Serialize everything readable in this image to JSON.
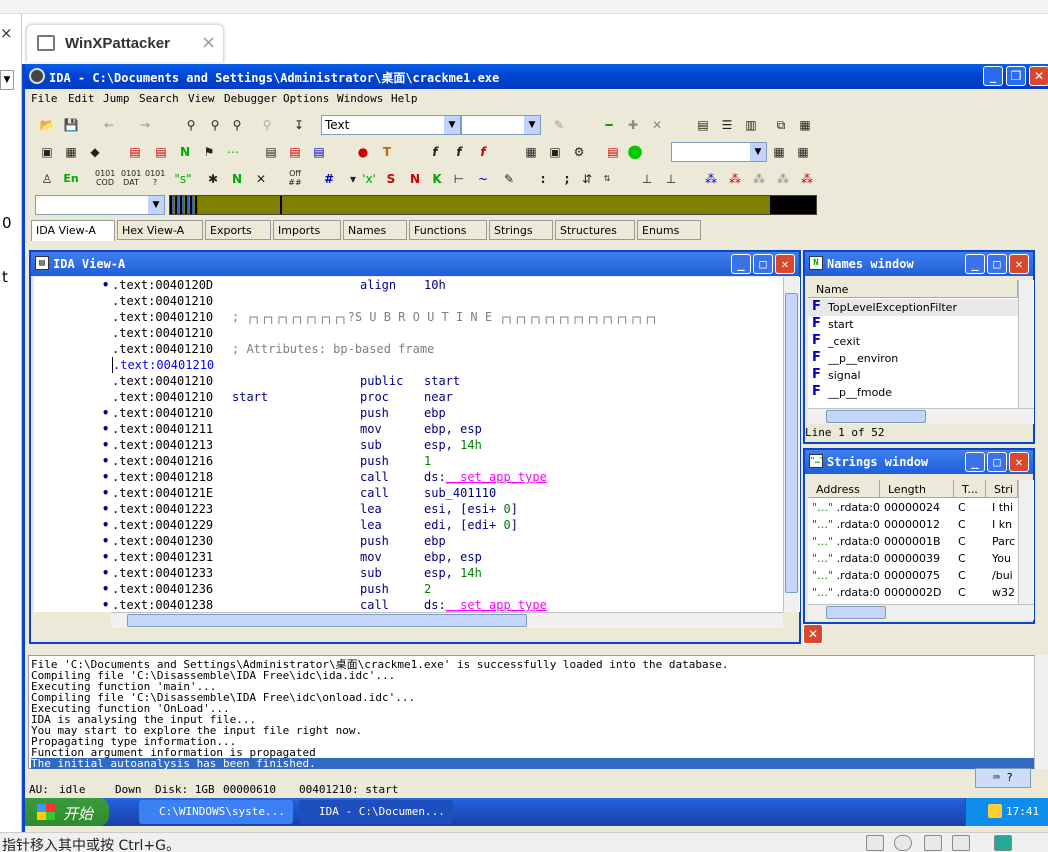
{
  "host": {
    "tab_title": "WinXPattacker",
    "left_char_0": "0",
    "left_char_t": "t",
    "bottom_hint": "指针移入其中或按 Ctrl+G。"
  },
  "ida": {
    "window_title": "IDA - C:\\Documents and Settings\\Administrator\\桌面\\crackme1.exe",
    "menu": [
      "File",
      "Edit",
      "Jump",
      "Search",
      "View",
      "Debugger",
      "Options",
      "Windows",
      "Help"
    ],
    "toolbar": {
      "text_combo": "Text",
      "empty_combo": "",
      "lang_label": "En"
    },
    "tabs": [
      {
        "label": "IDA View-A",
        "active": true
      },
      {
        "label": "Hex View-A"
      },
      {
        "label": "Exports"
      },
      {
        "label": "Imports"
      },
      {
        "label": "Names"
      },
      {
        "label": "Functions"
      },
      {
        "label": "Strings"
      },
      {
        "label": "Structures"
      },
      {
        "label": "Enums"
      }
    ],
    "view_title": "IDA View-A",
    "code_lines": [
      {
        "dot": true,
        "addr": ".text:0040120D",
        "lab": "",
        "ins": "align",
        "ops": "10h",
        "kind": "plain"
      },
      {
        "dot": false,
        "addr": ".text:00401210",
        "lab": "",
        "ins": "",
        "ops": "",
        "kind": "plain"
      },
      {
        "dot": false,
        "addr": ".text:00401210",
        "cmt": "; ┌┐┌┐┌┐┌┐┌┐┌┐┌┐?S U B R O U T I N E ┌┐┌┐┌┐┌┐┌┐┌┐┌┐┌┐┌┐┌┐┌┐",
        "kind": "comment"
      },
      {
        "dot": false,
        "addr": ".text:00401210",
        "lab": "",
        "ins": "",
        "ops": "",
        "kind": "plain"
      },
      {
        "dot": false,
        "addr": ".text:00401210",
        "cmt": "; Attributes: bp-based frame",
        "kind": "comment"
      },
      {
        "dot": false,
        "addr": ".text:00401210",
        "lab": "",
        "ins": "",
        "ops": "",
        "kind": "cursor"
      },
      {
        "dot": false,
        "addr": ".text:00401210",
        "lab": "",
        "ins": "public",
        "ops": "start",
        "kind": "plain"
      },
      {
        "dot": false,
        "addr": ".text:00401210",
        "lab": "start",
        "ins": "proc",
        "ops": "near",
        "kind": "plain"
      },
      {
        "dot": true,
        "addr": ".text:00401210",
        "lab": "",
        "ins": "push",
        "ops": "ebp",
        "kind": "plain"
      },
      {
        "dot": true,
        "addr": ".text:00401211",
        "lab": "",
        "ins": "mov",
        "ops": "ebp, esp",
        "kind": "plain"
      },
      {
        "dot": true,
        "addr": ".text:00401213",
        "lab": "",
        "ins": "sub",
        "ops": "esp,",
        "num": "14h",
        "kind": "num"
      },
      {
        "dot": true,
        "addr": ".text:00401216",
        "lab": "",
        "ins": "push",
        "ops": "",
        "num": "1",
        "kind": "num"
      },
      {
        "dot": true,
        "addr": ".text:00401218",
        "lab": "",
        "ins": "call",
        "ops": "ds:",
        "imp": "__set_app_type",
        "kind": "imp"
      },
      {
        "dot": true,
        "addr": ".text:0040121E",
        "lab": "",
        "ins": "call",
        "ops": "sub_401110",
        "kind": "plain"
      },
      {
        "dot": true,
        "addr": ".text:00401223",
        "lab": "",
        "ins": "lea",
        "ops": "esi, [esi+",
        "num": "0",
        "tail": "]",
        "kind": "num"
      },
      {
        "dot": true,
        "addr": ".text:00401229",
        "lab": "",
        "ins": "lea",
        "ops": "edi, [edi+",
        "num": "0",
        "tail": "]",
        "kind": "num"
      },
      {
        "dot": true,
        "addr": ".text:00401230",
        "lab": "",
        "ins": "push",
        "ops": "ebp",
        "kind": "plain"
      },
      {
        "dot": true,
        "addr": ".text:00401231",
        "lab": "",
        "ins": "mov",
        "ops": "ebp, esp",
        "kind": "plain"
      },
      {
        "dot": true,
        "addr": ".text:00401233",
        "lab": "",
        "ins": "sub",
        "ops": "esp,",
        "num": "14h",
        "kind": "num"
      },
      {
        "dot": true,
        "addr": ".text:00401236",
        "lab": "",
        "ins": "push",
        "ops": "",
        "num": "2",
        "kind": "num"
      },
      {
        "dot": true,
        "addr": ".text:00401238",
        "lab": "",
        "ins": "call",
        "ops": "ds:",
        "imp": "__set_app_type",
        "kind": "imp"
      }
    ],
    "names_window": {
      "title": "Names window",
      "header": "Name",
      "rows": [
        "TopLevelExceptionFilter",
        "start",
        "_cexit",
        "__p__environ",
        "signal",
        "__p__fmode"
      ],
      "status": "Line 1 of 52"
    },
    "strings_window": {
      "title": "Strings window",
      "headers": [
        "Address",
        "Length",
        "T...",
        "Stri"
      ],
      "rows": [
        [
          ".rdata:0...",
          "00000024",
          "C",
          "I thi"
        ],
        [
          ".rdata:0...",
          "00000012",
          "C",
          "I kn"
        ],
        [
          ".rdata:0...",
          "0000001B",
          "C",
          "Parc"
        ],
        [
          ".rdata:0...",
          "00000039",
          "C",
          "You"
        ],
        [
          ".rdata:0...",
          "00000075",
          "C",
          "/bui"
        ],
        [
          ".rdata:0...",
          "0000002D",
          "C",
          "w32"
        ]
      ]
    },
    "log_lines": [
      "File 'C:\\Documents and Settings\\Administrator\\桌面\\crackme1.exe' is successfully loaded into the database.",
      "Compiling file 'C:\\Disassemble\\IDA Free\\idc\\ida.idc'...",
      "Executing function 'main'...",
      "Compiling file 'C:\\Disassemble\\IDA Free\\idc\\onload.idc'...",
      "Executing function 'OnLoad'...",
      "IDA is analysing the input file...",
      "You may start to explore the input file right now.",
      "Propagating type information...",
      "Function argument information is propagated",
      "The initial autoanalysis has been finished."
    ],
    "status": {
      "au": "AU:",
      "state": "idle",
      "dir": "Down",
      "disk": "Disk: 1GB",
      "offset": "00000610",
      "location": "00401210: start"
    }
  },
  "taskbar": {
    "start": "开始",
    "tasks": [
      "C:\\WINDOWS\\syste...",
      "IDA - C:\\Documen..."
    ],
    "clock": "17:41"
  }
}
